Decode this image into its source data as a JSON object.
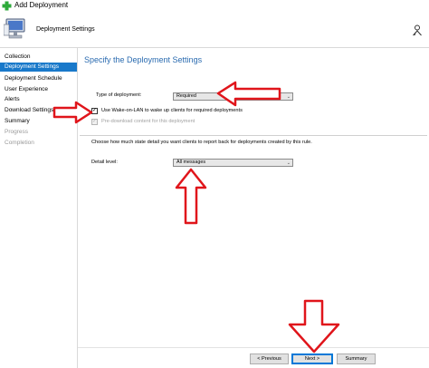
{
  "window": {
    "title": "Add Deployment"
  },
  "header": {
    "title": "Deployment Settings"
  },
  "sidebar": {
    "items": [
      {
        "label": "Collection",
        "state": "normal"
      },
      {
        "label": "Deployment Settings",
        "state": "active"
      },
      {
        "label": "Deployment Schedule",
        "state": "normal"
      },
      {
        "label": "User Experience",
        "state": "normal"
      },
      {
        "label": "Alerts",
        "state": "normal"
      },
      {
        "label": "Download Settings",
        "state": "normal"
      },
      {
        "label": "Summary",
        "state": "normal"
      },
      {
        "label": "Progress",
        "state": "disabled"
      },
      {
        "label": "Completion",
        "state": "disabled"
      }
    ]
  },
  "main": {
    "heading": "Specify the Deployment Settings",
    "type_of_deployment_label": "Type of deployment:",
    "type_of_deployment_value": "Required",
    "wake_on_lan_label": "Use Wake-on-LAN to wake up clients for required deployments",
    "wake_on_lan_checked": true,
    "predownload_label": "Pre-download content for this deployment",
    "predownload_checked": true,
    "predownload_enabled": false,
    "state_detail_text": "Choose how much state detail you want clients to report back for deployments created by this rule.",
    "detail_level_label": "Detail level:",
    "detail_level_value": "All messages"
  },
  "footer": {
    "previous_label": "< Previous",
    "next_label": "Next >",
    "summary_label": "Summary"
  },
  "colors": {
    "accent": "#1979ca",
    "heading": "#2a6bb0",
    "annotation_arrow": "#e0151b"
  },
  "icons": {
    "app": "green-plus-icon",
    "header": "computer-icon",
    "help": "help-person-icon"
  }
}
